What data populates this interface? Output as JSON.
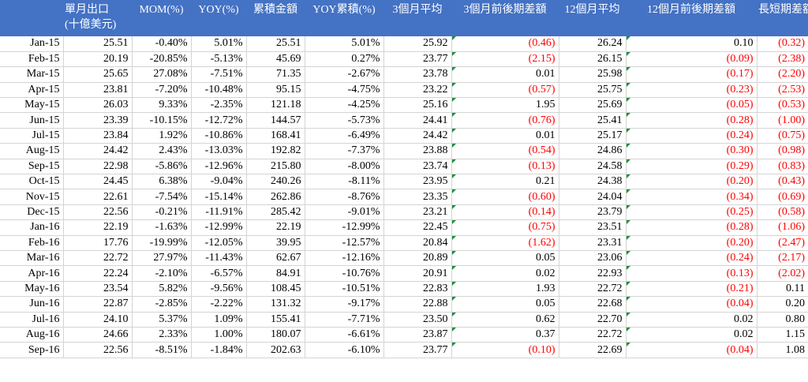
{
  "headers": [
    "",
    "單月出口\n(十億美元)",
    "MOM(%)",
    "YOY(%)",
    "累積金額",
    "YOY累積(%)",
    "3個月平均",
    "3個月前後期差額",
    "12個月平均",
    "12個月前後期差額",
    "長短期差額"
  ],
  "rows": [
    [
      "Jan-15",
      "25.51",
      "-0.40%",
      "5.01%",
      "25.51",
      "5.01%",
      "25.92",
      "(0.46)",
      "26.24",
      "0.10",
      "(0.32)"
    ],
    [
      "Feb-15",
      "20.19",
      "-20.85%",
      "-5.13%",
      "45.69",
      "0.27%",
      "23.77",
      "(2.15)",
      "26.15",
      "(0.09)",
      "(2.38)"
    ],
    [
      "Mar-15",
      "25.65",
      "27.08%",
      "-7.51%",
      "71.35",
      "-2.67%",
      "23.78",
      "0.01",
      "25.98",
      "(0.17)",
      "(2.20)"
    ],
    [
      "Apr-15",
      "23.81",
      "-7.20%",
      "-10.48%",
      "95.15",
      "-4.75%",
      "23.22",
      "(0.57)",
      "25.75",
      "(0.23)",
      "(2.53)"
    ],
    [
      "May-15",
      "26.03",
      "9.33%",
      "-2.35%",
      "121.18",
      "-4.25%",
      "25.16",
      "1.95",
      "25.69",
      "(0.05)",
      "(0.53)"
    ],
    [
      "Jun-15",
      "23.39",
      "-10.15%",
      "-12.72%",
      "144.57",
      "-5.73%",
      "24.41",
      "(0.76)",
      "25.41",
      "(0.28)",
      "(1.00)"
    ],
    [
      "Jul-15",
      "23.84",
      "1.92%",
      "-10.86%",
      "168.41",
      "-6.49%",
      "24.42",
      "0.01",
      "25.17",
      "(0.24)",
      "(0.75)"
    ],
    [
      "Aug-15",
      "24.42",
      "2.43%",
      "-13.03%",
      "192.82",
      "-7.37%",
      "23.88",
      "(0.54)",
      "24.86",
      "(0.30)",
      "(0.98)"
    ],
    [
      "Sep-15",
      "22.98",
      "-5.86%",
      "-12.96%",
      "215.80",
      "-8.00%",
      "23.74",
      "(0.13)",
      "24.58",
      "(0.29)",
      "(0.83)"
    ],
    [
      "Oct-15",
      "24.45",
      "6.38%",
      "-9.04%",
      "240.26",
      "-8.11%",
      "23.95",
      "0.21",
      "24.38",
      "(0.20)",
      "(0.43)"
    ],
    [
      "Nov-15",
      "22.61",
      "-7.54%",
      "-15.14%",
      "262.86",
      "-8.76%",
      "23.35",
      "(0.60)",
      "24.04",
      "(0.34)",
      "(0.69)"
    ],
    [
      "Dec-15",
      "22.56",
      "-0.21%",
      "-11.91%",
      "285.42",
      "-9.01%",
      "23.21",
      "(0.14)",
      "23.79",
      "(0.25)",
      "(0.58)"
    ],
    [
      "Jan-16",
      "22.19",
      "-1.63%",
      "-12.99%",
      "22.19",
      "-12.99%",
      "22.45",
      "(0.75)",
      "23.51",
      "(0.28)",
      "(1.06)"
    ],
    [
      "Feb-16",
      "17.76",
      "-19.99%",
      "-12.05%",
      "39.95",
      "-12.57%",
      "20.84",
      "(1.62)",
      "23.31",
      "(0.20)",
      "(2.47)"
    ],
    [
      "Mar-16",
      "22.72",
      "27.97%",
      "-11.43%",
      "62.67",
      "-12.16%",
      "20.89",
      "0.05",
      "23.06",
      "(0.24)",
      "(2.17)"
    ],
    [
      "Apr-16",
      "22.24",
      "-2.10%",
      "-6.57%",
      "84.91",
      "-10.76%",
      "20.91",
      "0.02",
      "22.93",
      "(0.13)",
      "(2.02)"
    ],
    [
      "May-16",
      "23.54",
      "5.82%",
      "-9.56%",
      "108.45",
      "-10.51%",
      "22.83",
      "1.93",
      "22.72",
      "(0.21)",
      "0.11"
    ],
    [
      "Jun-16",
      "22.87",
      "-2.85%",
      "-2.22%",
      "131.32",
      "-9.17%",
      "22.88",
      "0.05",
      "22.68",
      "(0.04)",
      "0.20"
    ],
    [
      "Jul-16",
      "24.10",
      "5.37%",
      "1.09%",
      "155.41",
      "-7.71%",
      "23.50",
      "0.62",
      "22.70",
      "0.02",
      "0.80"
    ],
    [
      "Aug-16",
      "24.66",
      "2.33%",
      "1.00%",
      "180.07",
      "-6.61%",
      "23.87",
      "0.37",
      "22.72",
      "0.02",
      "1.15"
    ],
    [
      "Sep-16",
      "22.56",
      "-8.51%",
      "-1.84%",
      "202.63",
      "-6.10%",
      "23.77",
      "(0.10)",
      "22.69",
      "(0.04)",
      "1.08"
    ]
  ],
  "colors": {
    "header_bg": "#4472c4",
    "header_text": "#ffffff",
    "negative": "#ff0000",
    "flag": "#1a8f3a"
  }
}
